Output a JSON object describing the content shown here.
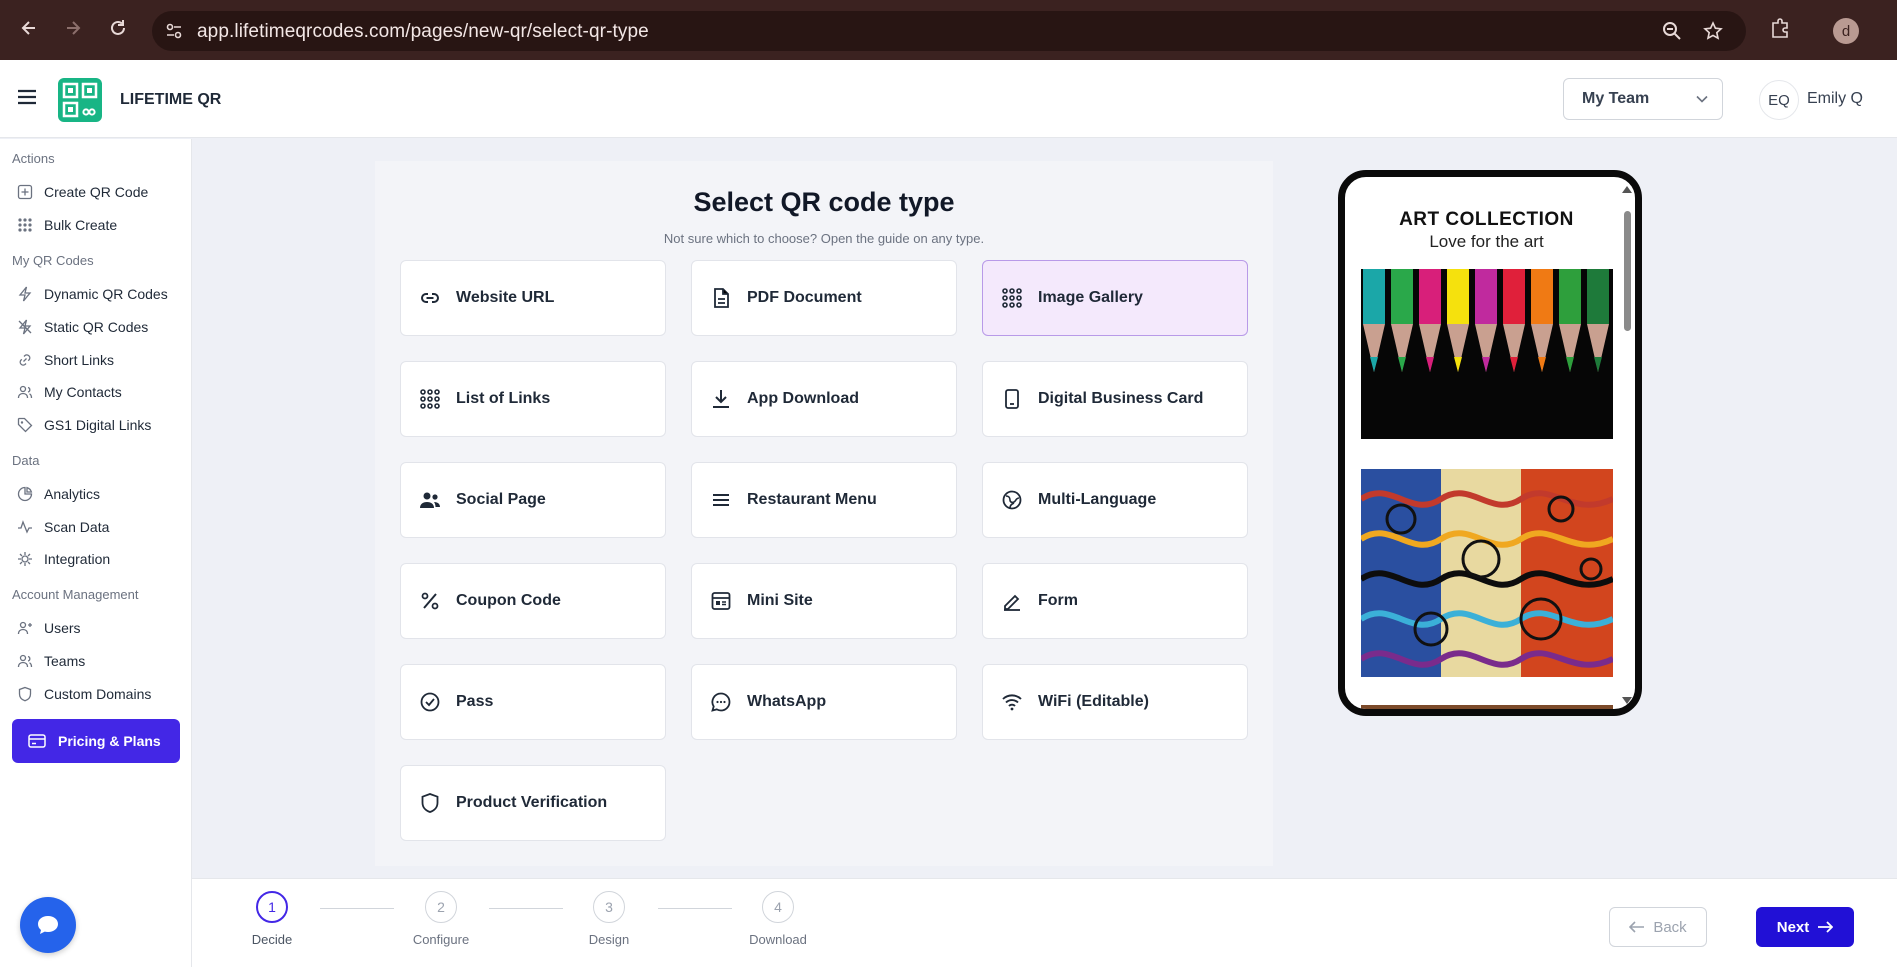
{
  "browser": {
    "url": "app.lifetimeqrcodes.com/pages/new-qr/select-qr-type",
    "profile_initial": "d"
  },
  "header": {
    "brand": "LIFETIME QR",
    "team_select": "My Team",
    "avatar_initials": "EQ",
    "user_name": "Emily Q"
  },
  "sidebar": {
    "sections": {
      "actions": "Actions",
      "my_qr_codes": "My QR Codes",
      "data": "Data",
      "account": "Account Management"
    },
    "items": {
      "create": "Create QR Code",
      "bulk": "Bulk Create",
      "dynamic": "Dynamic QR Codes",
      "static": "Static QR Codes",
      "short_links": "Short Links",
      "contacts": "My Contacts",
      "gs1": "GS1 Digital Links",
      "analytics": "Analytics",
      "scan_data": "Scan Data",
      "integration": "Integration",
      "users": "Users",
      "teams": "Teams",
      "domains": "Custom Domains"
    },
    "pricing": "Pricing & Plans"
  },
  "main": {
    "title": "Select QR code type",
    "subtitle": "Not sure which to choose? Open the guide on any type.",
    "types": [
      {
        "label": "Website URL",
        "icon": "link-icon"
      },
      {
        "label": "PDF Document",
        "icon": "document-icon"
      },
      {
        "label": "Image Gallery",
        "icon": "grid-icon",
        "selected": true
      },
      {
        "label": "List of Links",
        "icon": "grid-icon"
      },
      {
        "label": "App Download",
        "icon": "download-icon"
      },
      {
        "label": "Digital Business Card",
        "icon": "phone-card-icon"
      },
      {
        "label": "Social Page",
        "icon": "people-icon"
      },
      {
        "label": "Restaurant Menu",
        "icon": "menu-lines-icon"
      },
      {
        "label": "Multi-Language",
        "icon": "globe-icon"
      },
      {
        "label": "Coupon Code",
        "icon": "percent-icon"
      },
      {
        "label": "Mini Site",
        "icon": "browser-icon"
      },
      {
        "label": "Form",
        "icon": "pen-icon"
      },
      {
        "label": "Pass",
        "icon": "check-circle-icon"
      },
      {
        "label": "WhatsApp",
        "icon": "chat-icon"
      },
      {
        "label": "WiFi (Editable)",
        "icon": "wifi-icon"
      },
      {
        "label": "Product Verification",
        "icon": "shield-icon"
      }
    ]
  },
  "preview": {
    "title": "ART COLLECTION",
    "subtitle": "Love for the art"
  },
  "stepper": {
    "steps": [
      {
        "num": "1",
        "label": "Decide"
      },
      {
        "num": "2",
        "label": "Configure"
      },
      {
        "num": "3",
        "label": "Design"
      },
      {
        "num": "4",
        "label": "Download"
      }
    ],
    "back": "Back",
    "next": "Next"
  }
}
